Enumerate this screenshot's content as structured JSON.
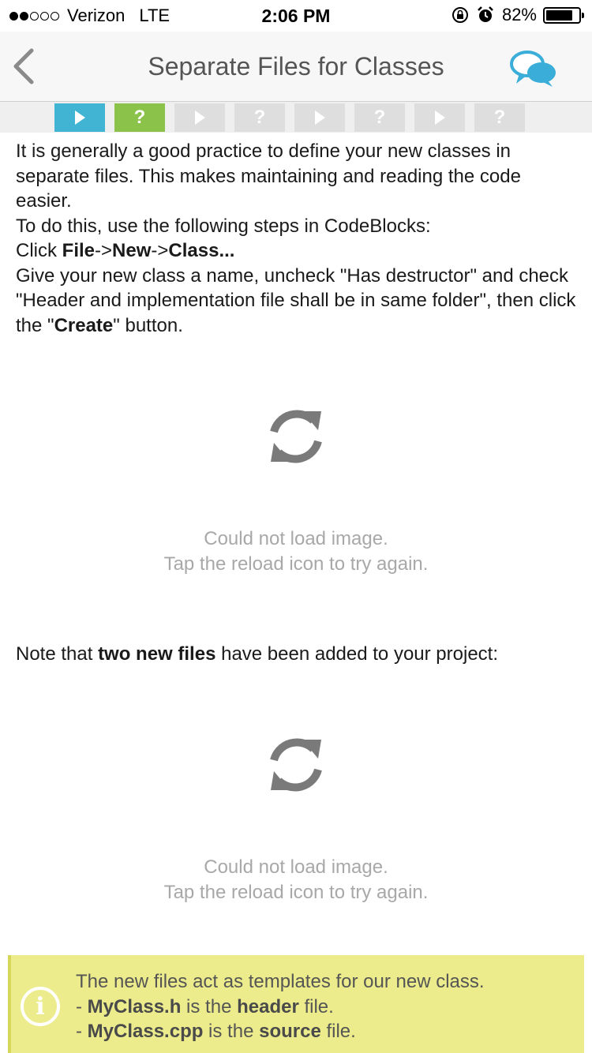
{
  "status_bar": {
    "carrier": "Verizon",
    "network": "LTE",
    "time": "2:06 PM",
    "battery": "82%",
    "battery_level": 0.82
  },
  "nav": {
    "title": "Separate Files for Classes"
  },
  "tabs": [
    {
      "type": "play",
      "state": "current"
    },
    {
      "type": "quiz",
      "label": "?",
      "state": "completed"
    },
    {
      "type": "play",
      "state": "locked"
    },
    {
      "type": "quiz",
      "label": "?",
      "state": "locked"
    },
    {
      "type": "play",
      "state": "locked"
    },
    {
      "type": "quiz",
      "label": "?",
      "state": "locked"
    },
    {
      "type": "play",
      "state": "locked"
    },
    {
      "type": "quiz",
      "label": "?",
      "state": "locked"
    }
  ],
  "content": {
    "para1": "It is generally a good practice to define your new classes in separate files. This makes maintaining and reading the code easier.",
    "steps_intro": "To do this, use the following steps in CodeBlocks:",
    "click_prefix": "Click ",
    "menu_file": "File",
    "arrow1": "->",
    "menu_new": "New",
    "arrow2": "->",
    "menu_class": "Class...",
    "instr_part1": "Give your new class a name, uncheck \"Has destructor\" and check \"Header and implementation file shall be in same folder\", then click the \"",
    "create_button": "Create",
    "instr_part2": "\" button.",
    "note_prefix": "Note that ",
    "note_bold": "two new files",
    "note_suffix": " have been added to your project:"
  },
  "image_placeholder": {
    "line1": "Could not load image.",
    "line2": "Tap the reload icon to try again."
  },
  "info": {
    "line1": "The new files act as templates for our new class.",
    "dash": "- ",
    "header_file": "MyClass.h",
    "is_the": " is the ",
    "header_word": "header",
    "file_word": " file.",
    "source_file": "MyClass.cpp",
    "source_word": "source"
  },
  "colors": {
    "accent_blue": "#41b3d3",
    "accent_green": "#8bc34a",
    "info_bg": "#ecec8c"
  },
  "icons": [
    "back-chevron-icon",
    "chat-bubbles-icon",
    "reload-icon",
    "info-icon",
    "alarm-icon",
    "rotation-lock-icon"
  ]
}
